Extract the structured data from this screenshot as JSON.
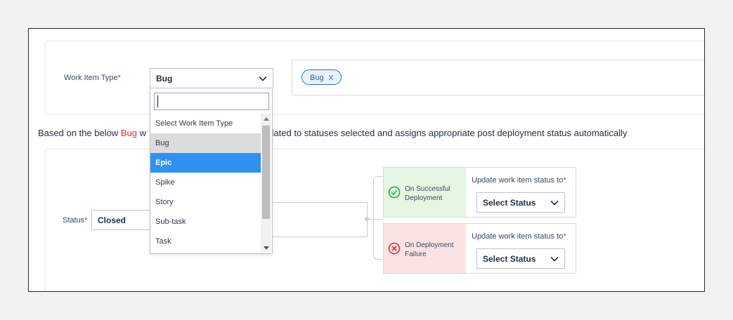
{
  "work_item_type": {
    "label": "Work Item Type",
    "required_mark": "*",
    "selected_value": "Bug",
    "tags": [
      {
        "label": "Bug",
        "remove": "X"
      }
    ]
  },
  "dropdown": {
    "search_value": "",
    "items": [
      {
        "label": "Select Work Item Type",
        "state": "normal"
      },
      {
        "label": "Bug",
        "state": "hover"
      },
      {
        "label": "Epic",
        "state": "active"
      },
      {
        "label": "Spike",
        "state": "normal"
      },
      {
        "label": "Story",
        "state": "normal"
      },
      {
        "label": "Sub-task",
        "state": "normal"
      },
      {
        "label": "Task",
        "state": "normal"
      }
    ]
  },
  "info": {
    "prefix": "Based on the below ",
    "highlight": "Bug",
    "fragment_before": " w",
    "suffix": "anges related to statuses selected and assigns appropriate post deployment status automatically"
  },
  "status": {
    "label": "Status",
    "required_mark": "*",
    "value": "Closed"
  },
  "outcomes": {
    "success": {
      "title_line1": "On Successful",
      "title_line2": "Deployment",
      "update_label": "Update work item status to",
      "required_mark": "*",
      "select_value": "Select Status"
    },
    "failure": {
      "title_line1": "On Deployment",
      "title_line2": "Failure",
      "update_label": "Update work item status to",
      "required_mark": "*",
      "select_value": "Select Status"
    }
  },
  "colors": {
    "accent": "#2f92f2",
    "required": "#e02d2d",
    "success_bg": "#e3f7e3",
    "failure_bg": "#fbe3e3"
  }
}
